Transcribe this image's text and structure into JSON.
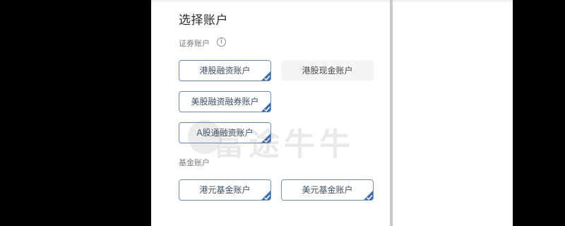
{
  "title": "选择账户",
  "securities": {
    "label": "证券账户",
    "info_icon": "info-icon",
    "accounts": [
      {
        "label": "港股融资账户",
        "selected": true
      },
      {
        "label": "港股现金账户",
        "selected": false
      },
      {
        "label": "美股融资融券账户",
        "selected": true
      },
      {
        "label": "A股通融资账户",
        "selected": true
      }
    ]
  },
  "funds": {
    "label": "基金账户",
    "accounts": [
      {
        "label": "港元基金账户",
        "selected": true
      },
      {
        "label": "美元基金账户",
        "selected": true
      }
    ]
  },
  "watermark": "富途牛牛",
  "colors": {
    "accent": "#3f6aa8",
    "chip_border": "#6e8fb5",
    "unselected_bg": "#f4f5f7"
  }
}
